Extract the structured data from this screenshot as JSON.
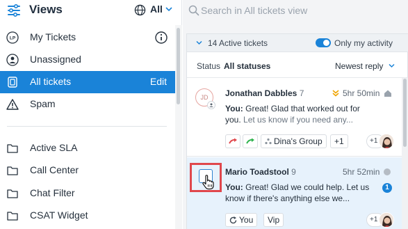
{
  "sidebar": {
    "title": "Views",
    "filter_selected": "All",
    "items": [
      {
        "label": "My Tickets",
        "icon": "lp-avatar-icon"
      },
      {
        "label": "Unassigned",
        "icon": "person-icon"
      },
      {
        "label": "All tickets",
        "icon": "tickets-icon",
        "active": true,
        "edit_label": "Edit"
      },
      {
        "label": "Spam",
        "icon": "warning-icon"
      },
      {
        "label": "Active SLA",
        "icon": "folder-icon"
      },
      {
        "label": "Call Center",
        "icon": "folder-icon"
      },
      {
        "label": "Chat Filter",
        "icon": "folder-icon"
      },
      {
        "label": "CSAT Widget",
        "icon": "folder-icon"
      }
    ],
    "my_tickets_avatar": "LP"
  },
  "search": {
    "placeholder": "Search in All tickets view"
  },
  "tickets_panel": {
    "count_label": "14 Active tickets",
    "only_my_activity": "Only my activity",
    "only_my_activity_on": true,
    "status_key": "Status",
    "status_value": "All statuses",
    "sort_label": "Newest reply"
  },
  "tickets": [
    {
      "initials": "JD",
      "name": "Jonathan Dabbles",
      "number": "7",
      "time": "5hr 50min",
      "msg_you": "You:",
      "msg_main": " Great! Glad that worked out for you.",
      "msg_faded": " Let us know if you need any...",
      "tags": [
        "Dina's Group",
        "+1"
      ],
      "agents_extra": "+1"
    },
    {
      "name": "Mario Toadstool",
      "number": "9",
      "time": "5hr 52min",
      "msg_you": "You:",
      "msg_main": " Great! Glad we could help. Let us know if there's anything else we...",
      "msg_faded": "",
      "tags": [
        "You",
        "Vip"
      ],
      "unread": "1",
      "agents_extra": "+1"
    }
  ],
  "colors": {
    "accent": "#1a83d8",
    "highlight_border": "#e0474c",
    "priority_arrow": "#f0a400"
  }
}
